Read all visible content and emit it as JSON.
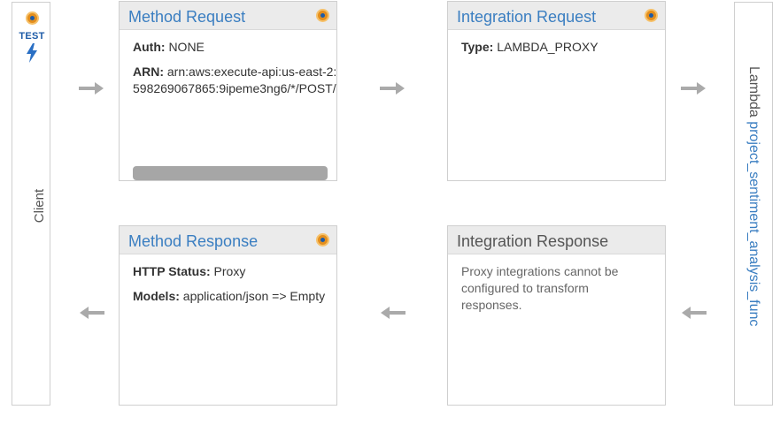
{
  "client": {
    "test_label": "TEST",
    "label": "Client"
  },
  "method_request": {
    "title": "Method Request",
    "auth_key": "Auth:",
    "auth_value": "NONE",
    "arn_key": "ARN:",
    "arn_value": "arn:aws:execute-api:us-east-2:598269067865:9ipeme3ng6/*/POST/"
  },
  "integration_request": {
    "title": "Integration Request",
    "type_key": "Type:",
    "type_value": "LAMBDA_PROXY"
  },
  "method_response": {
    "title": "Method Response",
    "status_key": "HTTP Status:",
    "status_value": "Proxy",
    "models_key": "Models:",
    "models_value": "application/json => Empty"
  },
  "integration_response": {
    "title": "Integration Response",
    "note": "Proxy integrations cannot be configured to transform responses."
  },
  "lambda": {
    "label": "Lambda",
    "function_name": "project_sentiment_analysis_func"
  },
  "icons": {
    "settings_dot": "orange-dot-icon",
    "test_bolt": "lightning-bolt-icon",
    "arrow_right": "arrow-right-icon",
    "arrow_left": "arrow-left-icon"
  },
  "colors": {
    "title_link": "#3a7ec1",
    "header_bg": "#ebebeb",
    "border": "#cfcfcf",
    "arrow": "#aaaaaa",
    "accent_orange": "#e38e1d"
  }
}
